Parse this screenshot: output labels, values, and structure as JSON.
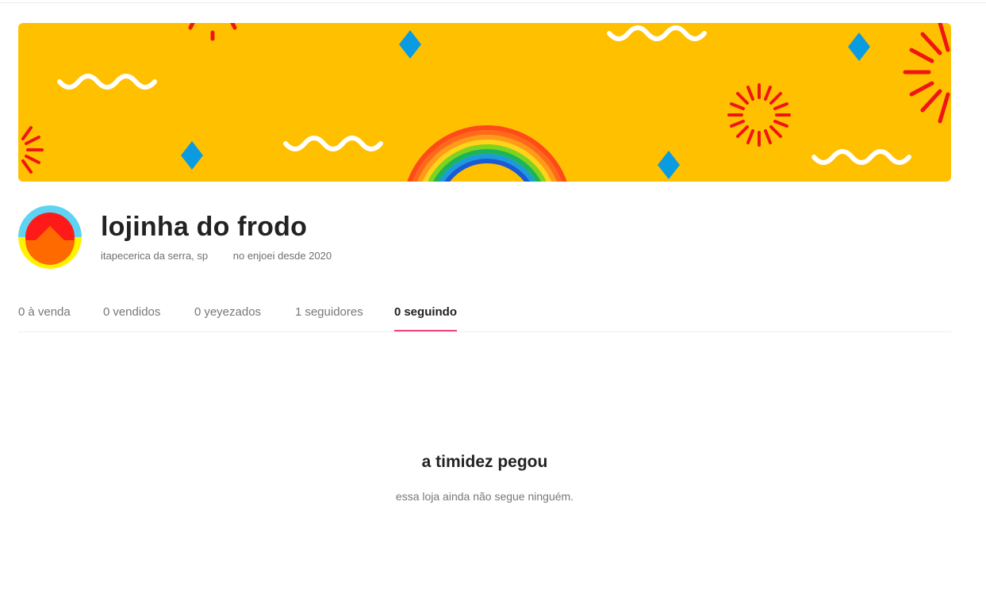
{
  "profile": {
    "store_name": "lojinha do frodo",
    "location": "itapecerica da serra, sp",
    "member_since": "no enjoei desde 2020"
  },
  "tabs": [
    {
      "count": "0",
      "label": "à venda"
    },
    {
      "count": "0",
      "label": "vendidos"
    },
    {
      "count": "0",
      "label": "yeyezados"
    },
    {
      "count": "1",
      "label": "seguidores"
    },
    {
      "count": "0",
      "label": "seguindo"
    }
  ],
  "active_tab": "seguindo",
  "empty_state": {
    "title": "a timidez pegou",
    "subtitle": "essa loja ainda não segue ninguém."
  },
  "colors": {
    "banner_bg": "#ffc000",
    "accent_tab": "#f0437d",
    "diamond": "#0a9be0",
    "burst": "#f01515"
  },
  "icons": {
    "avatar": "store-avatar-icon"
  }
}
